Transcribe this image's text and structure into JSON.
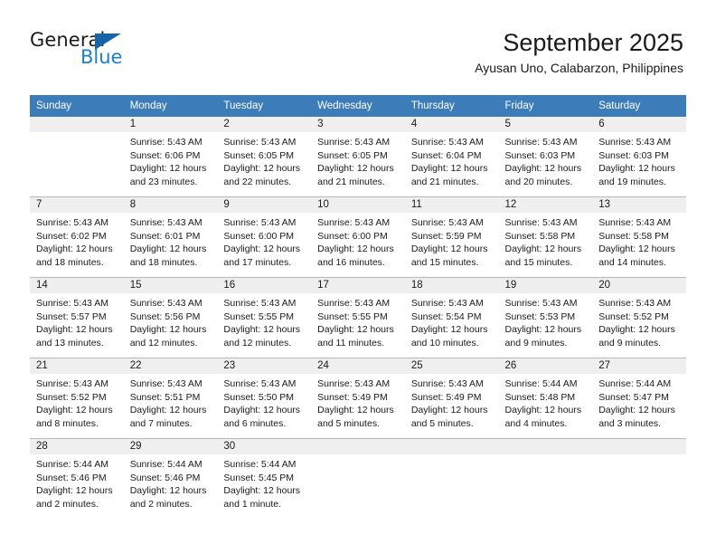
{
  "logo": {
    "primary_text": "General",
    "secondary_text": "Blue",
    "triangle_color": "#1565a8",
    "blue_color": "#1c7fd0"
  },
  "header": {
    "title": "September 2025",
    "subtitle": "Ayusan Uno, Calabarzon, Philippines"
  },
  "theme": {
    "header_row_bg": "#3b7cb9",
    "daynum_bg": "#efefef",
    "grid_line": "#b9b9b9",
    "text": "#1a1a1a"
  },
  "calendar": {
    "weekday_headers": [
      "Sunday",
      "Monday",
      "Tuesday",
      "Wednesday",
      "Thursday",
      "Friday",
      "Saturday"
    ],
    "weeks": [
      [
        {
          "day": "",
          "sunrise": "",
          "sunset": "",
          "daylight": "",
          "daylight_cont": ""
        },
        {
          "day": "1",
          "sunrise": "Sunrise: 5:43 AM",
          "sunset": "Sunset: 6:06 PM",
          "daylight": "Daylight: 12 hours",
          "daylight_cont": "and 23 minutes."
        },
        {
          "day": "2",
          "sunrise": "Sunrise: 5:43 AM",
          "sunset": "Sunset: 6:05 PM",
          "daylight": "Daylight: 12 hours",
          "daylight_cont": "and 22 minutes."
        },
        {
          "day": "3",
          "sunrise": "Sunrise: 5:43 AM",
          "sunset": "Sunset: 6:05 PM",
          "daylight": "Daylight: 12 hours",
          "daylight_cont": "and 21 minutes."
        },
        {
          "day": "4",
          "sunrise": "Sunrise: 5:43 AM",
          "sunset": "Sunset: 6:04 PM",
          "daylight": "Daylight: 12 hours",
          "daylight_cont": "and 21 minutes."
        },
        {
          "day": "5",
          "sunrise": "Sunrise: 5:43 AM",
          "sunset": "Sunset: 6:03 PM",
          "daylight": "Daylight: 12 hours",
          "daylight_cont": "and 20 minutes."
        },
        {
          "day": "6",
          "sunrise": "Sunrise: 5:43 AM",
          "sunset": "Sunset: 6:03 PM",
          "daylight": "Daylight: 12 hours",
          "daylight_cont": "and 19 minutes."
        }
      ],
      [
        {
          "day": "7",
          "sunrise": "Sunrise: 5:43 AM",
          "sunset": "Sunset: 6:02 PM",
          "daylight": "Daylight: 12 hours",
          "daylight_cont": "and 18 minutes."
        },
        {
          "day": "8",
          "sunrise": "Sunrise: 5:43 AM",
          "sunset": "Sunset: 6:01 PM",
          "daylight": "Daylight: 12 hours",
          "daylight_cont": "and 18 minutes."
        },
        {
          "day": "9",
          "sunrise": "Sunrise: 5:43 AM",
          "sunset": "Sunset: 6:00 PM",
          "daylight": "Daylight: 12 hours",
          "daylight_cont": "and 17 minutes."
        },
        {
          "day": "10",
          "sunrise": "Sunrise: 5:43 AM",
          "sunset": "Sunset: 6:00 PM",
          "daylight": "Daylight: 12 hours",
          "daylight_cont": "and 16 minutes."
        },
        {
          "day": "11",
          "sunrise": "Sunrise: 5:43 AM",
          "sunset": "Sunset: 5:59 PM",
          "daylight": "Daylight: 12 hours",
          "daylight_cont": "and 15 minutes."
        },
        {
          "day": "12",
          "sunrise": "Sunrise: 5:43 AM",
          "sunset": "Sunset: 5:58 PM",
          "daylight": "Daylight: 12 hours",
          "daylight_cont": "and 15 minutes."
        },
        {
          "day": "13",
          "sunrise": "Sunrise: 5:43 AM",
          "sunset": "Sunset: 5:58 PM",
          "daylight": "Daylight: 12 hours",
          "daylight_cont": "and 14 minutes."
        }
      ],
      [
        {
          "day": "14",
          "sunrise": "Sunrise: 5:43 AM",
          "sunset": "Sunset: 5:57 PM",
          "daylight": "Daylight: 12 hours",
          "daylight_cont": "and 13 minutes."
        },
        {
          "day": "15",
          "sunrise": "Sunrise: 5:43 AM",
          "sunset": "Sunset: 5:56 PM",
          "daylight": "Daylight: 12 hours",
          "daylight_cont": "and 12 minutes."
        },
        {
          "day": "16",
          "sunrise": "Sunrise: 5:43 AM",
          "sunset": "Sunset: 5:55 PM",
          "daylight": "Daylight: 12 hours",
          "daylight_cont": "and 12 minutes."
        },
        {
          "day": "17",
          "sunrise": "Sunrise: 5:43 AM",
          "sunset": "Sunset: 5:55 PM",
          "daylight": "Daylight: 12 hours",
          "daylight_cont": "and 11 minutes."
        },
        {
          "day": "18",
          "sunrise": "Sunrise: 5:43 AM",
          "sunset": "Sunset: 5:54 PM",
          "daylight": "Daylight: 12 hours",
          "daylight_cont": "and 10 minutes."
        },
        {
          "day": "19",
          "sunrise": "Sunrise: 5:43 AM",
          "sunset": "Sunset: 5:53 PM",
          "daylight": "Daylight: 12 hours",
          "daylight_cont": "and 9 minutes."
        },
        {
          "day": "20",
          "sunrise": "Sunrise: 5:43 AM",
          "sunset": "Sunset: 5:52 PM",
          "daylight": "Daylight: 12 hours",
          "daylight_cont": "and 9 minutes."
        }
      ],
      [
        {
          "day": "21",
          "sunrise": "Sunrise: 5:43 AM",
          "sunset": "Sunset: 5:52 PM",
          "daylight": "Daylight: 12 hours",
          "daylight_cont": "and 8 minutes."
        },
        {
          "day": "22",
          "sunrise": "Sunrise: 5:43 AM",
          "sunset": "Sunset: 5:51 PM",
          "daylight": "Daylight: 12 hours",
          "daylight_cont": "and 7 minutes."
        },
        {
          "day": "23",
          "sunrise": "Sunrise: 5:43 AM",
          "sunset": "Sunset: 5:50 PM",
          "daylight": "Daylight: 12 hours",
          "daylight_cont": "and 6 minutes."
        },
        {
          "day": "24",
          "sunrise": "Sunrise: 5:43 AM",
          "sunset": "Sunset: 5:49 PM",
          "daylight": "Daylight: 12 hours",
          "daylight_cont": "and 5 minutes."
        },
        {
          "day": "25",
          "sunrise": "Sunrise: 5:43 AM",
          "sunset": "Sunset: 5:49 PM",
          "daylight": "Daylight: 12 hours",
          "daylight_cont": "and 5 minutes."
        },
        {
          "day": "26",
          "sunrise": "Sunrise: 5:44 AM",
          "sunset": "Sunset: 5:48 PM",
          "daylight": "Daylight: 12 hours",
          "daylight_cont": "and 4 minutes."
        },
        {
          "day": "27",
          "sunrise": "Sunrise: 5:44 AM",
          "sunset": "Sunset: 5:47 PM",
          "daylight": "Daylight: 12 hours",
          "daylight_cont": "and 3 minutes."
        }
      ],
      [
        {
          "day": "28",
          "sunrise": "Sunrise: 5:44 AM",
          "sunset": "Sunset: 5:46 PM",
          "daylight": "Daylight: 12 hours",
          "daylight_cont": "and 2 minutes."
        },
        {
          "day": "29",
          "sunrise": "Sunrise: 5:44 AM",
          "sunset": "Sunset: 5:46 PM",
          "daylight": "Daylight: 12 hours",
          "daylight_cont": "and 2 minutes."
        },
        {
          "day": "30",
          "sunrise": "Sunrise: 5:44 AM",
          "sunset": "Sunset: 5:45 PM",
          "daylight": "Daylight: 12 hours",
          "daylight_cont": "and 1 minute."
        },
        {
          "day": "",
          "sunrise": "",
          "sunset": "",
          "daylight": "",
          "daylight_cont": ""
        },
        {
          "day": "",
          "sunrise": "",
          "sunset": "",
          "daylight": "",
          "daylight_cont": ""
        },
        {
          "day": "",
          "sunrise": "",
          "sunset": "",
          "daylight": "",
          "daylight_cont": ""
        },
        {
          "day": "",
          "sunrise": "",
          "sunset": "",
          "daylight": "",
          "daylight_cont": ""
        }
      ]
    ]
  }
}
